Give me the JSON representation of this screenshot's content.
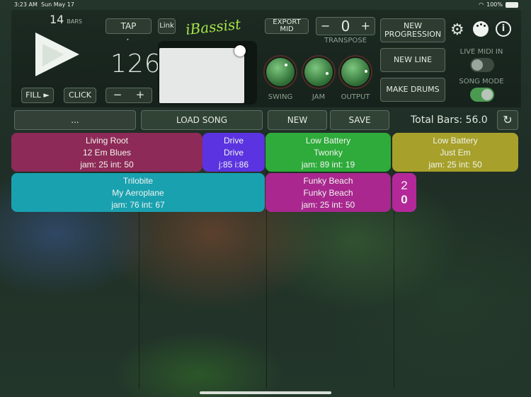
{
  "status": {
    "time": "3:23 AM",
    "date": "Sun May 17",
    "battery": "100%"
  },
  "transport": {
    "bars_value": "14",
    "bars_label": "BARS",
    "fill": "FILL ►",
    "click": "CLICK",
    "tap": "TAP",
    "link": "Link",
    "tempo": "126",
    "minus": "−",
    "plus": "+",
    "tap_dot": "•"
  },
  "brand": "iBassist",
  "export": {
    "label": "EXPORT MID"
  },
  "transpose": {
    "value": "0",
    "label": "TRANSPOSE",
    "minus": "−",
    "plus": "+"
  },
  "knobs": [
    {
      "label": "SWING"
    },
    {
      "label": "JAM"
    },
    {
      "label": "OUTPUT"
    }
  ],
  "actions": {
    "new_progression": "NEW PROGRESSION",
    "new_line": "NEW LINE",
    "make_drums": "MAKE DRUMS"
  },
  "toggles": {
    "live_midi": {
      "label": "LIVE MIDI IN",
      "on": false
    },
    "song_mode": {
      "label": "SONG MODE",
      "on": true
    }
  },
  "song_bar": {
    "dots": "...",
    "load": "LOAD SONG",
    "new": "NEW",
    "save": "SAVE",
    "total": "Total Bars: 56.0"
  },
  "clips": [
    {
      "l1": "Living Root",
      "l2": "12 Em Blues",
      "l3": "jam: 25 int: 50",
      "color": "#8e2a57"
    },
    {
      "l1": "Drive",
      "l2": "Drive",
      "l3": "j:85 i:86",
      "color": "#5b33e0"
    },
    {
      "l1": "Low Battery",
      "l2": "Twonky",
      "l3": "jam: 89 int: 19",
      "color": "#2eab3a"
    },
    {
      "l1": "Low Battery",
      "l2": "Just Em",
      "l3": "jam: 25 int: 50",
      "color": "#a7a02a"
    },
    {
      "l1": "Trilobite",
      "l2": "My Aeroplane",
      "l3": "jam: 76 int: 67",
      "color": "#19a1b0"
    },
    {
      "l1": "Funky Beach",
      "l2": "Funky Beach",
      "l3": "jam: 25 int: 50",
      "color": "#a9278f"
    },
    {
      "l1": "2",
      "l2": "0",
      "color": "#b4289a"
    }
  ]
}
